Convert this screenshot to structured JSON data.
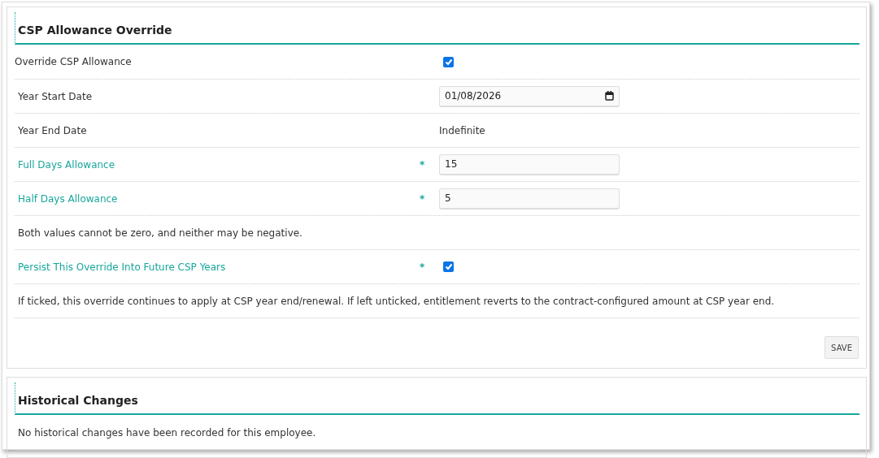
{
  "panels": [
    {
      "title": "CSP Allowance Override",
      "rows": [
        {
          "kind": "checkbox",
          "label": "Override CSP Allowance",
          "checked": true,
          "highlight": false
        },
        {
          "kind": "date",
          "label": "Year Start Date",
          "value": "01/08/2026",
          "highlight": false
        },
        {
          "kind": "text",
          "label": "Year End Date",
          "value": "Indefinite",
          "highlight": false
        },
        {
          "kind": "number",
          "label": "Full Days Allowance",
          "value": "15",
          "marker": "*",
          "highlight": true
        },
        {
          "kind": "number",
          "label": "Half Days Allowance",
          "value": "5",
          "marker": "*",
          "highlight": true
        },
        {
          "kind": "note",
          "text": "Both values cannot be zero, and neither may be negative."
        },
        {
          "kind": "checkbox",
          "label": "Persist This Override Into Future CSP Years",
          "checked": true,
          "marker": "*",
          "highlight": true
        },
        {
          "kind": "note",
          "text": "If ticked, this override continues to apply at CSP year end/renewal. If left unticked, entitlement reverts to the contract-configured amount at CSP year end."
        }
      ],
      "button": "SAVE"
    },
    {
      "title": "Historical Changes",
      "rows": [
        {
          "kind": "note",
          "text": "No historical changes have been recorded for this employee."
        }
      ]
    }
  ]
}
